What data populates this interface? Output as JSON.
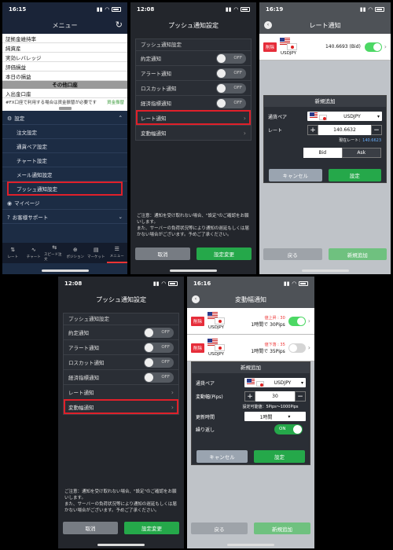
{
  "menu": {
    "time": "16:15",
    "title": "メニュー",
    "white_rows": [
      "証拠金維持率",
      "純資産",
      "実効レバレッジ",
      "評価損益",
      "本日の損益"
    ],
    "section": "その他口座",
    "account": "入出金口座",
    "note": "#FX口座で利用する場合は資金振替が必要です",
    "note_link": "資金振替",
    "settings": "設定",
    "items": [
      "注文設定",
      "通貨ペア設定",
      "チャート設定",
      "メール通知設定",
      "プッシュ通知設定"
    ],
    "mypage": "マイページ",
    "support": "お客様サポート",
    "tabs": [
      "レート",
      "チャート",
      "スピード注文",
      "ポジション",
      "マーケット",
      "メニュー"
    ]
  },
  "push": {
    "time": "12:08",
    "title": "プッシュ通知設定",
    "box_title": "プッシュ通知設定",
    "rows": [
      {
        "label": "約定通知",
        "state": "OFF"
      },
      {
        "label": "アラート通知",
        "state": "OFF"
      },
      {
        "label": "ロスカット通知",
        "state": "OFF"
      },
      {
        "label": "経済指標通知",
        "state": "OFF"
      }
    ],
    "rate_row": "レート通知",
    "change_row": "変動幅通知",
    "notice": "ご注意：通知を受け取れない場合、\"設定\"のご確認をお願いします。\nまた、サーバーの負荷状況等により通知の遅延もしくは届かない場合がございます。予めご了承ください。",
    "cancel": "取消",
    "save": "設定変更"
  },
  "rate": {
    "time": "16:19",
    "title": "レート通知",
    "delete": "削除",
    "pair": "USDJPY",
    "value": "140.6693 (Bid)",
    "dialog_title": "新規追加",
    "pair_label": "通貨ペア",
    "pair_value": "USDJPY",
    "rate_label": "レート",
    "rate_value": "140.6632",
    "current_label": "現在レート：",
    "current_value": "140.6623",
    "bid": "Bid",
    "ask": "Ask",
    "cancel": "キャンセル",
    "set": "設定",
    "back": "戻る",
    "add": "新規追加"
  },
  "change": {
    "time": "16:16",
    "title": "変動幅通知",
    "delete": "削除",
    "list": [
      {
        "pair": "USDJPY",
        "top": "値上昇 : 30",
        "text": "1時間で 30Pips"
      },
      {
        "pair": "USDJPY",
        "top": "値下落 : 35",
        "text": "1時間で 35Pips"
      }
    ],
    "dialog_title": "新規追加",
    "pair_label": "通貨ペア",
    "pair_value": "USDJPY",
    "width_label": "変動幅(Pips)",
    "width_value": "30",
    "range_note": "設定可能値：5Pips〜1000Pips",
    "interval_label": "更新時間",
    "interval_value": "1時間",
    "repeat_label": "繰り返し",
    "repeat_state": "ON",
    "cancel": "キャンセル",
    "set": "設定",
    "back": "戻る",
    "add": "新規追加"
  },
  "colors": {
    "accent_green": "#25a84a",
    "highlight_red": "#e0202a",
    "menu_bg": "#1c2c44"
  }
}
